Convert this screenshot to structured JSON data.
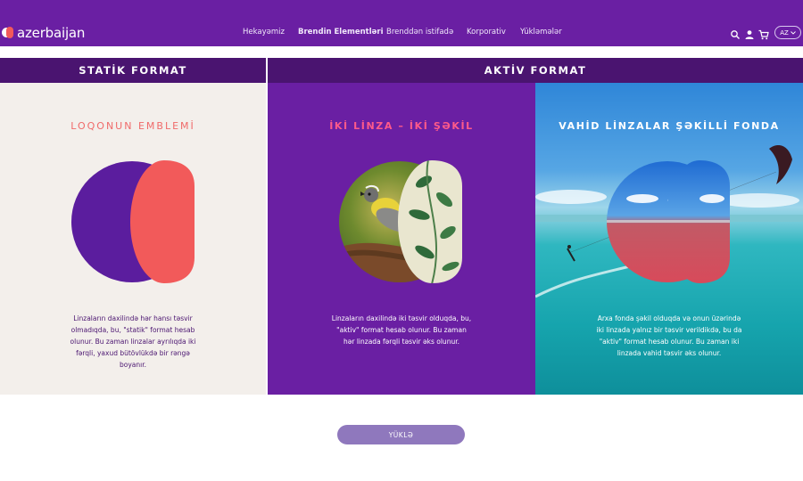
{
  "brand": {
    "name": "azerbaijan"
  },
  "nav": {
    "links": [
      "Hekayəmiz",
      "Brendin Elementləri",
      "Brenddən istifadə",
      "Korporativ",
      "Yükləmələr"
    ],
    "language": "AZ",
    "icons": [
      "search-icon",
      "user-icon",
      "cart-icon"
    ]
  },
  "headers": {
    "static": "STATİK FORMAT",
    "active": "AKTİV FORMAT"
  },
  "panels": [
    {
      "title": "LOQONUN EMBLEMİ",
      "description": "Linzaların daxilində hər hansı təsvir olmadıqda, bu, \"statik\" format hesab olunur. Bu zaman linzalar ayrılıqda iki fərqli, yaxud bütövlükdə bir rəngə boyanır."
    },
    {
      "title": "İKİ LİNZA – İKİ ŞƏKİL",
      "description": "Linzaların daxilində iki təsvir olduqda, bu, \"aktiv\" format hesab olunur. Bu zaman hər linzada fərqli təsvir əks olunur."
    },
    {
      "title": "VAHİD LİNZALAR ŞƏKİLLİ FONDA",
      "description": "Arxa fonda şəkil olduqda və onun üzərində iki linzada yalnız bir təsvir verildikdə, bu da \"aktiv\" format hesab olunur. Bu zaman iki linzada vahid təsvir əks olunur."
    }
  ],
  "download_button": "YÜKLƏ",
  "colors": {
    "purple": "#6a1fa3",
    "dark_purple": "#4a1470",
    "coral": "#f25a5a",
    "light_bg": "#f3efeb"
  }
}
